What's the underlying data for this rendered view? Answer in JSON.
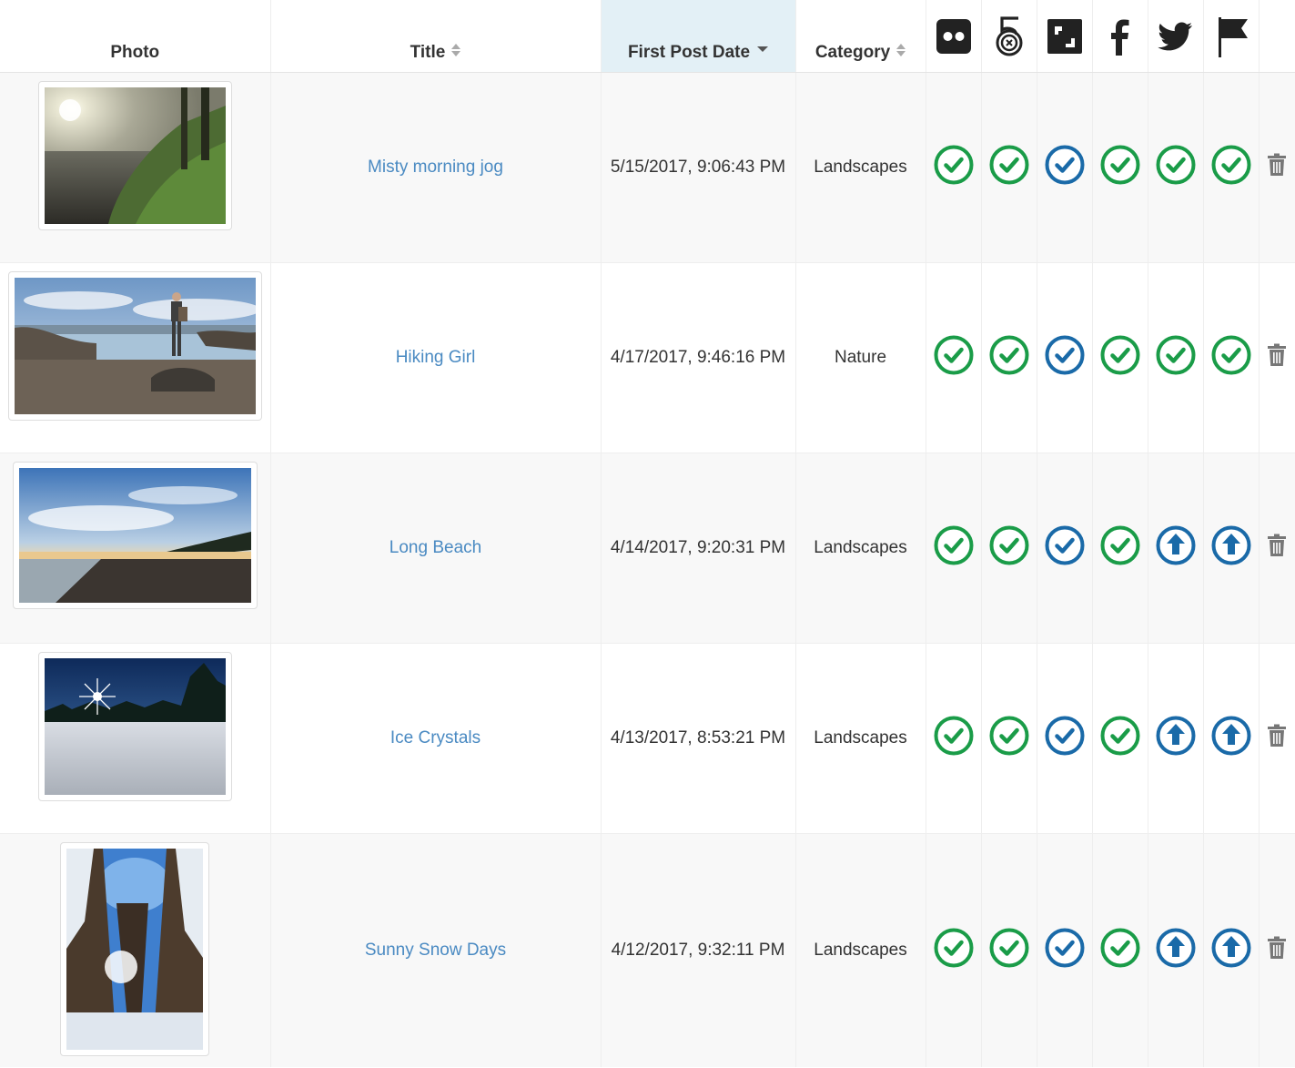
{
  "columns": {
    "photo": "Photo",
    "title": "Title",
    "first_post_date": "First Post Date",
    "category": "Category"
  },
  "service_icons": [
    "flickr-icon",
    "500px-icon",
    "smugmug-icon",
    "facebook-icon",
    "twitter-icon",
    "flag-icon"
  ],
  "colors": {
    "posted_green": "#1a9c48",
    "scheduled_blue": "#1a6aa8",
    "link": "#4a8ac2",
    "sorted_header_bg": "#e3f0f6"
  },
  "rows": [
    {
      "title": "Misty morning jog",
      "date": "5/15/2017, 9:06:43 PM",
      "category": "Landscapes",
      "status": [
        "check-green",
        "check-green",
        "check-blue",
        "check-green",
        "check-green",
        "check-green"
      ]
    },
    {
      "title": "Hiking Girl",
      "date": "4/17/2017, 9:46:16 PM",
      "category": "Nature",
      "status": [
        "check-green",
        "check-green",
        "check-blue",
        "check-green",
        "check-green",
        "check-green"
      ]
    },
    {
      "title": "Long Beach",
      "date": "4/14/2017, 9:20:31 PM",
      "category": "Landscapes",
      "status": [
        "check-green",
        "check-green",
        "check-blue",
        "check-green",
        "upload-blue",
        "upload-blue"
      ]
    },
    {
      "title": "Ice Crystals",
      "date": "4/13/2017, 8:53:21 PM",
      "category": "Landscapes",
      "status": [
        "check-green",
        "check-green",
        "check-blue",
        "check-green",
        "upload-blue",
        "upload-blue"
      ]
    },
    {
      "title": "Sunny Snow Days",
      "date": "4/12/2017, 9:32:11 PM",
      "category": "Landscapes",
      "status": [
        "check-green",
        "check-green",
        "check-blue",
        "check-green",
        "upload-blue",
        "upload-blue"
      ]
    }
  ]
}
